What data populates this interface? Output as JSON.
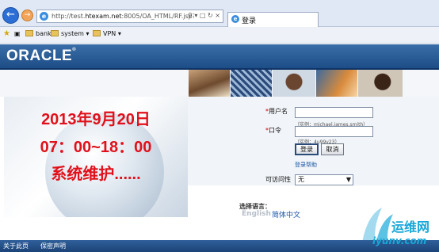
{
  "browser": {
    "url_prefix": "http://test.",
    "url_host": "htexam.net",
    "url_rest": ":8005/OA_HTML/RF.jsp?func",
    "tab_label": "登录",
    "favorites": [
      {
        "label": "bank"
      },
      {
        "label": "system"
      },
      {
        "label": "VPN"
      }
    ]
  },
  "brand": {
    "logo": "ORACLE",
    "registered": "®"
  },
  "notice": {
    "line1": "2013年9月20日",
    "line2": "07：00~18：00",
    "line3": "系统维护......"
  },
  "login": {
    "username_label": "用户名",
    "username_value": "",
    "username_hint": "（实例：michael.james.smith）",
    "password_label": "口令",
    "password_value": "",
    "password_hint": "（实例：4u99v23）",
    "login_button": "登录",
    "cancel_button": "取消",
    "help_link": "登录帮助",
    "accessibility_label": "可访问性",
    "accessibility_value": "无"
  },
  "language": {
    "label": "选择语言：",
    "english": "English",
    "chinese": "简体中文"
  },
  "footer": {
    "about": "关于此页",
    "privacy": "保密声明"
  },
  "watermark": {
    "text1": "运维网",
    "text2": "iyunv.com"
  },
  "colors": {
    "notice_red": "#e0111b",
    "oracle_blue": "#1d4d86",
    "link_blue": "#1d55a5"
  }
}
